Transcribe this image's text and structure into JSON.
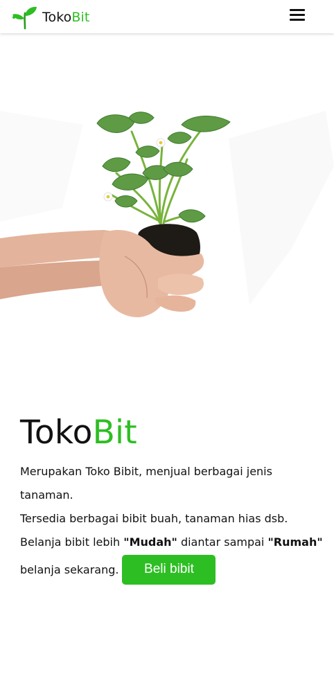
{
  "navbar": {
    "brand_part1": "Toko",
    "brand_part2": "Bit",
    "logo_icon": "sprout-icon",
    "menu_icon": "hamburger-menu-icon"
  },
  "hero": {
    "image_icon": "hands-holding-seedling-image"
  },
  "main": {
    "title_part1": "Toko",
    "title_part2": "Bit",
    "line1": "Merupakan Toko Bibit, menjual berbagai jenis tanaman.",
    "line2": "Tersedia berbagai bibit buah, tanaman hias dsb.",
    "line3_prefix": "Belanja bibit lebih ",
    "line3_bold1": "\"Mudah\"",
    "line3_mid": " diantar sampai ",
    "line3_bold2": "\"Rumah\"",
    "cta_lead": "belanja sekarang.",
    "cta_button": "Beli bibit"
  },
  "colors": {
    "brand_green": "#2dbe23",
    "text": "#111111",
    "background": "#ffffff"
  }
}
